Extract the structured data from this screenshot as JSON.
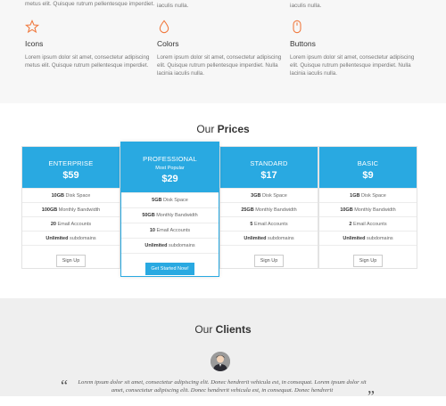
{
  "features": {
    "top_texts": [
      "metus elit. Quisque rutrum pellentesque imperdiet.",
      "iaculis nulla.",
      "iaculis nulla."
    ],
    "items": [
      {
        "icon": "star-icon",
        "title": "Icons",
        "desc": "Lorem ipsum dolor sit amet, consectetur adipiscing metus elit. Quisque rutrum pellentesque imperdiet."
      },
      {
        "icon": "droplet-icon",
        "title": "Colors",
        "desc": "Lorem ipsum dolor sit amet, consectetur adipiscing elit. Quisque rutrum pellentesque imperdiet. Nulla lacinia iaculis nulla."
      },
      {
        "icon": "mouse-icon",
        "title": "Buttons",
        "desc": "Lorem ipsum dolor sit amet, consectetur adipiscing elit. Quisque rutrum pellentesque imperdiet. Nulla lacinia iaculis nulla."
      }
    ],
    "accent": "#f0783c"
  },
  "prices": {
    "title_light": "Our ",
    "title_bold": "Prices",
    "accent": "#29a9e1",
    "plans": [
      {
        "name": "ENTERPRISE",
        "price": "$59",
        "rows": [
          [
            "10GB",
            " Disk Space"
          ],
          [
            "100GB",
            " Monthly Bandwidth"
          ],
          [
            "20",
            " Email Accounts"
          ],
          [
            "Unlimited",
            " subdomains"
          ]
        ],
        "button": "Sign Up"
      },
      {
        "name": "PROFESSIONAL",
        "note": "Most Popular",
        "price": "$29",
        "rows": [
          [
            "5GB",
            " Disk Space"
          ],
          [
            "50GB",
            " Monthly Bandwidth"
          ],
          [
            "10",
            " Email Accounts"
          ],
          [
            "Unlimited",
            " subdomains"
          ]
        ],
        "button": "Get Started Now!"
      },
      {
        "name": "STANDARD",
        "price": "$17",
        "rows": [
          [
            "3GB",
            " Disk Space"
          ],
          [
            "25GB",
            " Monthly Bandwidth"
          ],
          [
            "5",
            " Email Accounts"
          ],
          [
            "Unlimited",
            " subdomains"
          ]
        ],
        "button": "Sign Up"
      },
      {
        "name": "BASIC",
        "price": "$9",
        "rows": [
          [
            "1GB",
            " Disk Space"
          ],
          [
            "10GB",
            " Monthly Bandwidth"
          ],
          [
            "2",
            " Email Accounts"
          ],
          [
            "Unlimited",
            " subdomains"
          ]
        ],
        "button": "Sign Up"
      }
    ]
  },
  "clients": {
    "title_light": "Our ",
    "title_bold": "Clients",
    "quote": "Lorem ipsum dolor sit amet, consectetur adipiscing elit. Donec hendrerit vehicula est, in consequat. Lorem ipsum dolor sit amet, consectetur adipiscing elit. Donec hendrerit vehicula est, in consequat. Donec hendrerit",
    "open_mark": "“",
    "close_mark": "”"
  }
}
